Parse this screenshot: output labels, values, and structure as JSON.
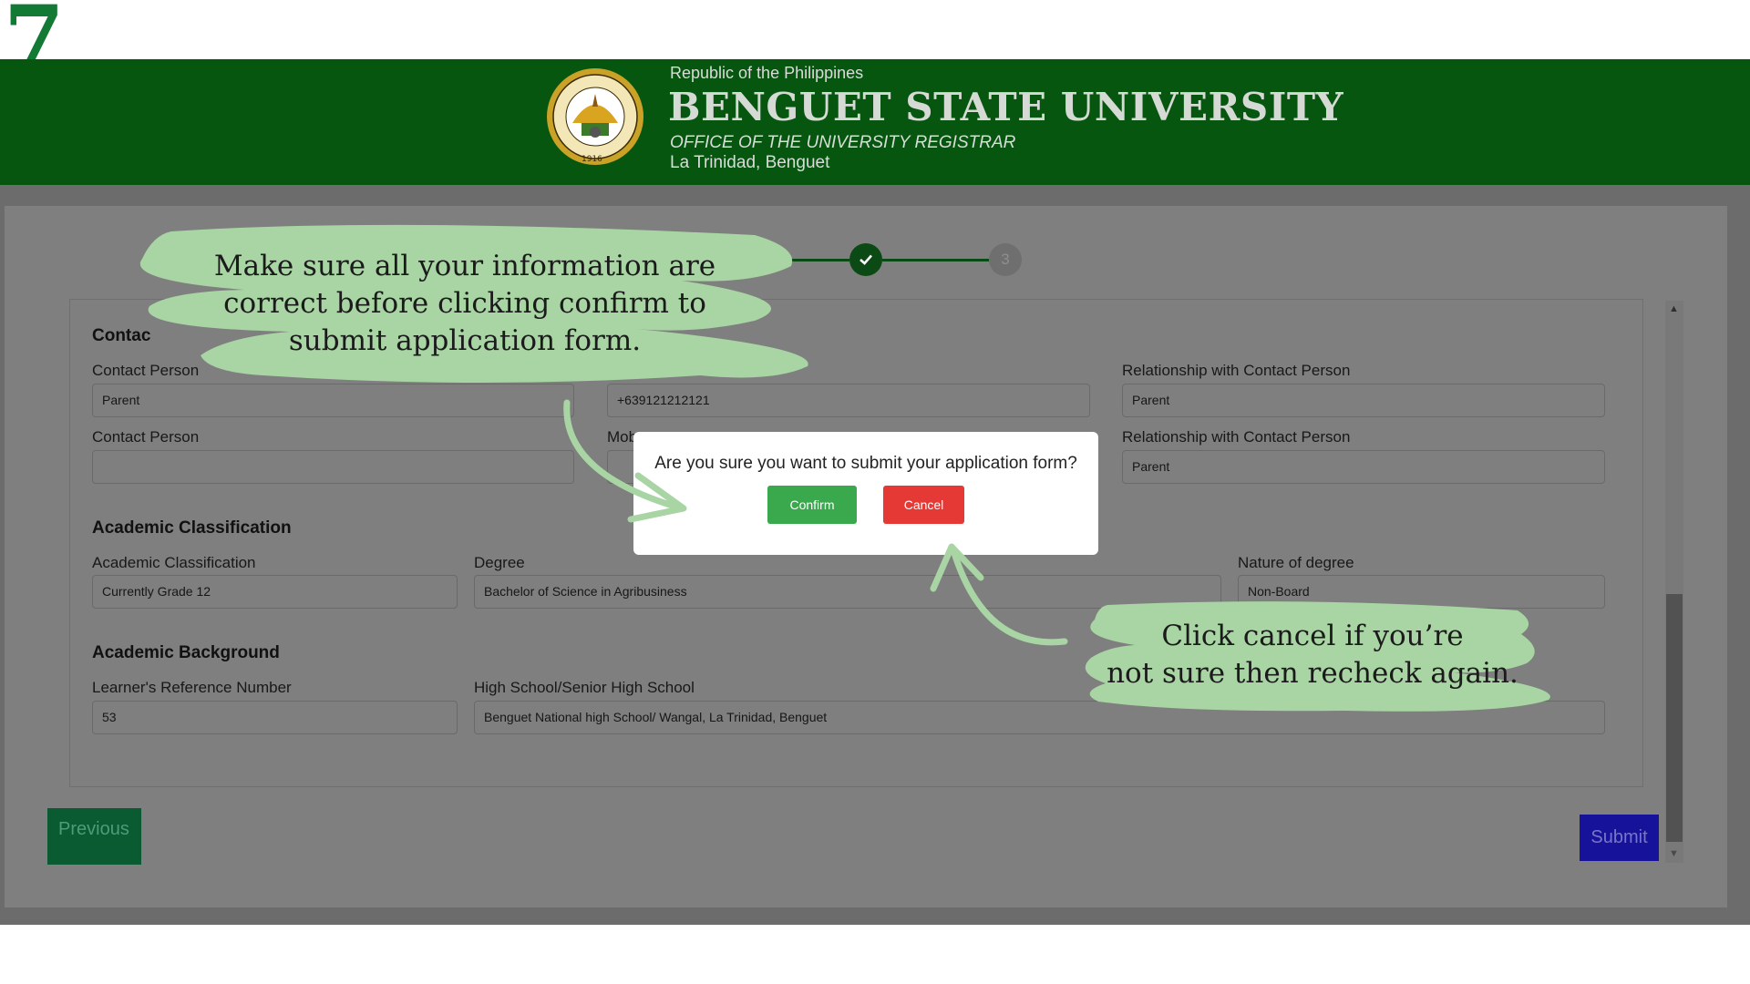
{
  "step_number": "7",
  "header": {
    "republic": "Republic of the Philippines",
    "university": "BENGUET STATE UNIVERSITY",
    "office": "OFFICE OF THE UNIVERSITY REGISTRAR",
    "location": "La Trinidad, Benguet",
    "seal_text_top": "BENGUET STATE UNIVERSITY",
    "seal_year": "1916"
  },
  "stepper": {
    "done_icon": "check-icon",
    "pending_label": "3"
  },
  "contact": {
    "title": "Contac",
    "row1": {
      "contact_label": "Contact Person",
      "contact_value": "Parent",
      "mobile_value": "+639121212121",
      "relationship_label": "Relationship with Contact Person",
      "relationship_value": "Parent"
    },
    "row2": {
      "contact_label": "Contact Person",
      "contact_value": "",
      "mobile_label": "Mob",
      "relationship_label": "Relationship with Contact Person",
      "relationship_value": "Parent"
    }
  },
  "academic_classification": {
    "title": "Academic Classification",
    "classification_label": "Academic Classification",
    "classification_value": "Currently Grade 12",
    "degree_label": "Degree",
    "degree_value": "Bachelor of Science in Agribusiness",
    "nature_label": "Nature of degree",
    "nature_value": "Non-Board"
  },
  "academic_background": {
    "title": "Academic Background",
    "lrn_label": "Learner's Reference Number",
    "lrn_value": "53",
    "school_label": "High School/Senior High School",
    "school_value": "Benguet National high School/ Wangal, La Trinidad, Benguet"
  },
  "buttons": {
    "previous": "Previous",
    "submit": "Submit"
  },
  "modal": {
    "question": "Are you sure you want to submit your application form?",
    "confirm": "Confirm",
    "cancel": "Cancel"
  },
  "annotations": {
    "top": [
      "Make sure all your information are",
      "correct before clicking confirm to",
      "submit application form."
    ],
    "bottom": [
      "Click cancel if you’re",
      "not sure then recheck again."
    ]
  },
  "colors": {
    "header_green": "#06560f",
    "overlay_grey": "#7f7f7f",
    "confirm_green": "#3aa84c",
    "cancel_red": "#e53935",
    "submit_blue": "#16129a",
    "annotation_green": "#a8d5a3"
  }
}
